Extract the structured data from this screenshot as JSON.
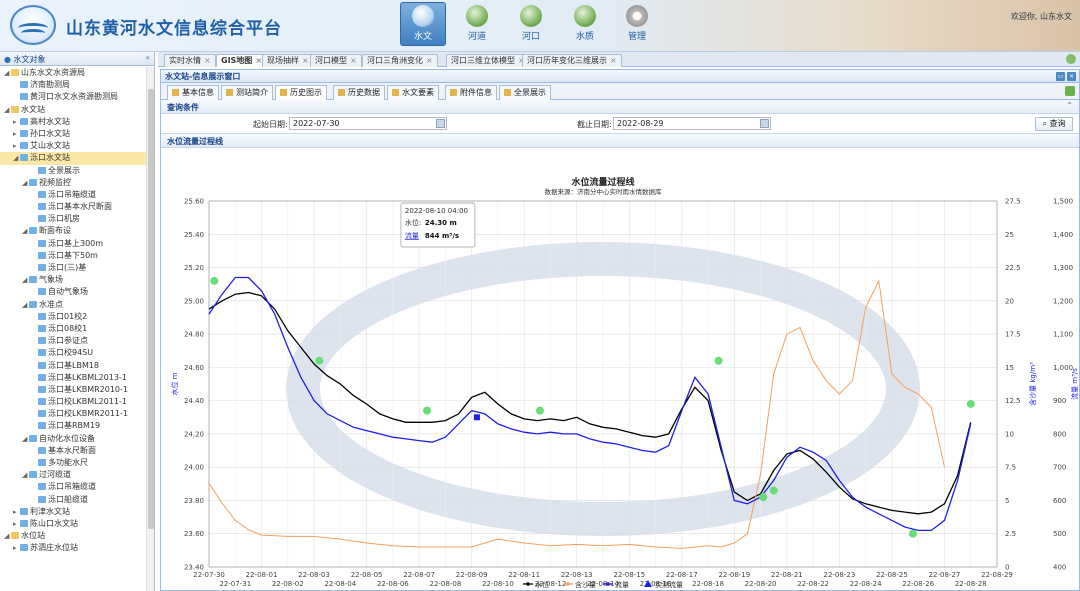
{
  "app": {
    "title": "山东黄河水文信息综合平台",
    "user": "欢迎你, 山东水文"
  },
  "nav": [
    {
      "label": "水文",
      "icon": "water-icon",
      "active": true
    },
    {
      "label": "河道",
      "icon": "river-channel-icon",
      "active": false
    },
    {
      "label": "河口",
      "icon": "estuary-icon",
      "active": false
    },
    {
      "label": "水质",
      "icon": "water-quality-icon",
      "active": false
    },
    {
      "label": "管理",
      "icon": "gear-icon",
      "active": false
    }
  ],
  "left_panel": {
    "title": "水文对象"
  },
  "tree": [
    {
      "label": "山东水文水资源局",
      "level": 0,
      "toggle": "◢",
      "icon": "folder"
    },
    {
      "label": "济南勘测局",
      "level": 1,
      "toggle": "",
      "icon": "node"
    },
    {
      "label": "黄河口水文水资源勘测局",
      "level": 1,
      "toggle": "",
      "icon": "node"
    },
    {
      "label": "水文站",
      "level": 0,
      "toggle": "◢",
      "icon": "folder"
    },
    {
      "label": "高村水文站",
      "level": 1,
      "toggle": "▸",
      "icon": "node"
    },
    {
      "label": "孙口水文站",
      "level": 1,
      "toggle": "▸",
      "icon": "node"
    },
    {
      "label": "艾山水文站",
      "level": 1,
      "toggle": "▸",
      "icon": "node"
    },
    {
      "label": "泺口水文站",
      "level": 1,
      "toggle": "◢",
      "icon": "node",
      "selected": true
    },
    {
      "label": "全景展示",
      "level": 3,
      "toggle": "",
      "icon": "node"
    },
    {
      "label": "视频监控",
      "level": 2,
      "toggle": "◢",
      "icon": "node"
    },
    {
      "label": "泺口吊箱缆道",
      "level": 3,
      "toggle": "",
      "icon": "node"
    },
    {
      "label": "泺口基本水尺断面",
      "level": 3,
      "toggle": "",
      "icon": "node"
    },
    {
      "label": "泺口机房",
      "level": 3,
      "toggle": "",
      "icon": "node"
    },
    {
      "label": "断面布设",
      "level": 2,
      "toggle": "◢",
      "icon": "node"
    },
    {
      "label": "泺口基上300m",
      "level": 3,
      "toggle": "",
      "icon": "node"
    },
    {
      "label": "泺口基下50m",
      "level": 3,
      "toggle": "",
      "icon": "node"
    },
    {
      "label": "泺口(三)基",
      "level": 3,
      "toggle": "",
      "icon": "node"
    },
    {
      "label": "气象场",
      "level": 2,
      "toggle": "◢",
      "icon": "node"
    },
    {
      "label": "自动气象场",
      "level": 3,
      "toggle": "",
      "icon": "node"
    },
    {
      "label": "水准点",
      "level": 2,
      "toggle": "◢",
      "icon": "node"
    },
    {
      "label": "泺口01校2",
      "level": 3,
      "toggle": "",
      "icon": "node"
    },
    {
      "label": "泺口08校1",
      "level": 3,
      "toggle": "",
      "icon": "node"
    },
    {
      "label": "泺口参证点",
      "level": 3,
      "toggle": "",
      "icon": "node"
    },
    {
      "label": "泺口校94SU",
      "level": 3,
      "toggle": "",
      "icon": "node"
    },
    {
      "label": "泺口基LBM18",
      "level": 3,
      "toggle": "",
      "icon": "node"
    },
    {
      "label": "泺口基LKBML2013-1",
      "level": 3,
      "toggle": "",
      "icon": "node"
    },
    {
      "label": "泺口基LKBMR2010-1",
      "level": 3,
      "toggle": "",
      "icon": "node"
    },
    {
      "label": "泺口校LKBML2011-1",
      "level": 3,
      "toggle": "",
      "icon": "node"
    },
    {
      "label": "泺口校LKBMR2011-1",
      "level": 3,
      "toggle": "",
      "icon": "node"
    },
    {
      "label": "泺口基RBM19",
      "level": 3,
      "toggle": "",
      "icon": "node"
    },
    {
      "label": "自动化水位设备",
      "level": 2,
      "toggle": "◢",
      "icon": "node"
    },
    {
      "label": "基本水尺断面",
      "level": 3,
      "toggle": "",
      "icon": "node"
    },
    {
      "label": "多功能水尺",
      "level": 3,
      "toggle": "",
      "icon": "node"
    },
    {
      "label": "过河缆道",
      "level": 2,
      "toggle": "◢",
      "icon": "node"
    },
    {
      "label": "泺口吊箱缆道",
      "level": 3,
      "toggle": "",
      "icon": "node"
    },
    {
      "label": "泺口船缆道",
      "level": 3,
      "toggle": "",
      "icon": "node"
    },
    {
      "label": "利津水文站",
      "level": 1,
      "toggle": "▸",
      "icon": "node"
    },
    {
      "label": "陈山口水文站",
      "level": 1,
      "toggle": "▸",
      "icon": "node"
    },
    {
      "label": "水位站",
      "level": 0,
      "toggle": "◢",
      "icon": "folder"
    },
    {
      "label": "苏泗庄水位站",
      "level": 1,
      "toggle": "▸",
      "icon": "node"
    }
  ],
  "top_tabs": [
    {
      "label": "实时水情",
      "active": false
    },
    {
      "label": "GIS地图",
      "active": true
    },
    {
      "label": "现场抽样",
      "active": false
    },
    {
      "label": "河口模型",
      "active": false
    },
    {
      "label": "河口三角洲变化",
      "active": false
    },
    {
      "label": "河口三维立体模型",
      "active": false
    },
    {
      "label": "河口历年变化三维展示",
      "active": false
    }
  ],
  "panel_title": "水文站-信息展示窗口",
  "sub_tabs": [
    {
      "label": "基本信息",
      "active": false
    },
    {
      "label": "测站简介",
      "active": false
    },
    {
      "label": "历史图示",
      "active": true
    },
    {
      "label": "历史数据",
      "active": false
    },
    {
      "label": "水文要素",
      "active": false
    },
    {
      "label": "附件信息",
      "active": false
    },
    {
      "label": "全景展示",
      "active": false
    }
  ],
  "query": {
    "section_title": "查询条件",
    "start_label": "起始日期:",
    "start_value": "2022-07-30",
    "end_label": "截止日期:",
    "end_value": "2022-08-29",
    "button": "查询"
  },
  "chart_section_title": "水位流量过程线",
  "colors": {
    "stage": "#000000",
    "sediment": "#f5a05a",
    "flow": "#1f1fe6",
    "measured": "#66dd77",
    "accent": "#1f5fa8"
  },
  "chart_data": {
    "type": "line",
    "title": "水位流量过程线",
    "subtitle": "数据来源：济南分中心实时雨水情数据库",
    "y_left_label": "水位 m",
    "y_right1_label": "含沙量 kg/m³",
    "y_right2_label": "流量 m³/s",
    "ylim_left": [
      23.4,
      25.6
    ],
    "ylim_right1": [
      0,
      27.5
    ],
    "ylim_right2": [
      400,
      1500
    ],
    "y_left_ticks": [
      "25.60",
      "25.40",
      "25.20",
      "25.00",
      "24.80",
      "24.60",
      "24.40",
      "24.20",
      "24.00",
      "23.80",
      "23.60",
      "23.40"
    ],
    "y_right1_ticks": [
      "27.5",
      "25",
      "22.5",
      "20",
      "17.5",
      "15",
      "12.5",
      "10",
      "7.5",
      "5",
      "2.5",
      "0"
    ],
    "y_right2_ticks": [
      "1,500",
      "1,400",
      "1,300",
      "1,200",
      "1,100",
      "1,000",
      "900",
      "800",
      "700",
      "600",
      "500",
      "400"
    ],
    "x_ticks_top": [
      "22-07-30",
      "22-08-01",
      "22-08-03",
      "22-08-05",
      "22-08-07",
      "22-08-09",
      "22-08-11",
      "22-08-13",
      "22-08-15",
      "22-08-17",
      "22-08-19",
      "22-08-21",
      "22-08-23",
      "22-08-25",
      "22-08-27",
      "22-08-29"
    ],
    "x_ticks_bottom": [
      "22-07-31",
      "22-08-02",
      "22-08-04",
      "22-08-06",
      "22-08-08",
      "22-08-10",
      "22-08-12",
      "22-08-14",
      "22-08-16",
      "22-08-18",
      "22-08-20",
      "22-08-22",
      "22-08-24",
      "22-08-26",
      "22-08-28"
    ],
    "x_range_days": [
      0,
      30
    ],
    "legend_position": "bottom-center",
    "series": [
      {
        "name": "水位",
        "axis": "left",
        "x": [
          0,
          0.5,
          1,
          1.5,
          2,
          2.5,
          3,
          3.5,
          4,
          4.5,
          5,
          5.5,
          6,
          6.5,
          7,
          7.5,
          8,
          8.5,
          9,
          9.5,
          10,
          10.5,
          11,
          11.5,
          12,
          12.5,
          13,
          13.5,
          14,
          14.5,
          15,
          15.5,
          16,
          16.5,
          17,
          17.5,
          18,
          18.5,
          19,
          19.5,
          20,
          20.5,
          21,
          21.5,
          22,
          22.5,
          23,
          23.5,
          24,
          24.5,
          25,
          25.5,
          26,
          26.5,
          27,
          27.5,
          28,
          28.5,
          29
        ],
        "y": [
          24.95,
          25.0,
          25.04,
          25.05,
          25.03,
          24.95,
          24.82,
          24.72,
          24.62,
          24.55,
          24.5,
          24.43,
          24.38,
          24.32,
          24.29,
          24.27,
          24.27,
          24.27,
          24.28,
          24.32,
          24.42,
          24.45,
          24.38,
          24.32,
          24.29,
          24.28,
          24.29,
          24.28,
          24.3,
          24.26,
          24.24,
          24.23,
          24.21,
          24.19,
          24.18,
          24.2,
          24.35,
          24.48,
          24.4,
          24.1,
          23.85,
          23.8,
          23.84,
          23.98,
          24.08,
          24.1,
          24.05,
          23.97,
          23.88,
          23.81,
          23.78,
          23.76,
          23.74,
          23.73,
          23.72,
          23.73,
          23.78,
          23.95,
          24.27
        ]
      },
      {
        "name": "含沙量",
        "axis": "right1",
        "x": [
          0,
          0.5,
          1,
          1.5,
          2,
          3,
          4,
          5,
          6,
          7,
          8,
          9,
          10,
          11,
          12,
          13,
          14,
          15,
          16,
          17,
          18,
          19,
          19.5,
          20,
          20.5,
          21,
          21.5,
          22,
          22.5,
          23,
          23.5,
          24,
          24.5,
          25,
          25.5,
          26,
          26.5,
          27,
          27.5,
          28
        ],
        "y": [
          6.3,
          4.8,
          3.5,
          2.8,
          2.4,
          2.3,
          2.3,
          2.1,
          1.8,
          1.6,
          1.5,
          1.5,
          1.5,
          2.1,
          1.8,
          1.6,
          1.7,
          1.6,
          1.7,
          1.5,
          1.4,
          1.6,
          1.5,
          1.8,
          2.5,
          7.0,
          14.5,
          17.5,
          18.0,
          15.5,
          14.0,
          13.0,
          14.0,
          19.5,
          21.5,
          14.5,
          13.5,
          13.0,
          12.0,
          7.5
        ]
      },
      {
        "name": "流量",
        "axis": "right2",
        "x": [
          0,
          0.5,
          1,
          1.5,
          2,
          2.5,
          3,
          3.5,
          4,
          4.5,
          5,
          5.5,
          6,
          6.5,
          7,
          7.5,
          8,
          8.5,
          9,
          9.5,
          10,
          10.5,
          11,
          11.5,
          12,
          12.5,
          13,
          13.5,
          14,
          14.5,
          15,
          15.5,
          16,
          16.5,
          17,
          17.5,
          18,
          18.5,
          19,
          19.5,
          20,
          20.5,
          21,
          21.5,
          22,
          22.5,
          23,
          23.5,
          24,
          24.5,
          25,
          25.5,
          26,
          26.5,
          27,
          27.5,
          28,
          28.5,
          29
        ],
        "y": [
          1160,
          1220,
          1270,
          1270,
          1230,
          1160,
          1060,
          970,
          900,
          860,
          840,
          820,
          810,
          800,
          790,
          785,
          780,
          775,
          790,
          830,
          870,
          860,
          830,
          815,
          805,
          800,
          805,
          800,
          800,
          785,
          775,
          770,
          760,
          750,
          745,
          765,
          870,
          970,
          920,
          760,
          600,
          590,
          610,
          660,
          730,
          760,
          745,
          720,
          660,
          610,
          580,
          560,
          540,
          520,
          510,
          510,
          540,
          660,
          830
        ]
      },
      {
        "name": "实测流量",
        "axis": "right2",
        "x": [
          0.2,
          4.2,
          8.3,
          12.6,
          19.4,
          21.1,
          21.5,
          26.8,
          29.0
        ],
        "y": [
          1260,
          1020,
          870,
          870,
          1020,
          610,
          630,
          500,
          890
        ]
      }
    ],
    "tooltip": {
      "time": "2022-08-10 04:00",
      "stage_label": "水位:",
      "stage_value": "24.30 m",
      "flow_label": "流量",
      "flow_value": "844 m³/s",
      "at_day": 10.2
    }
  }
}
